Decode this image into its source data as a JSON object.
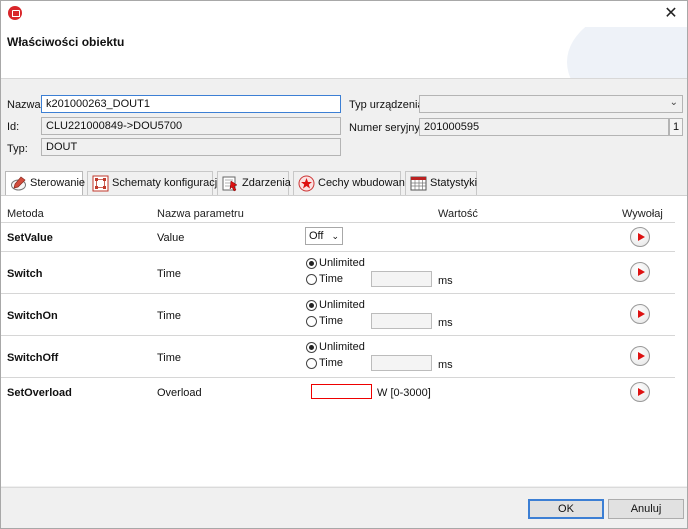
{
  "dialog": {
    "title": "Właściwości obiektu",
    "close_label": "✕"
  },
  "form": {
    "name_label": "Nazwa:",
    "name_value": "k201000263_DOUT1",
    "id_label": "Id:",
    "id_value": "CLU221000849->DOU5700",
    "type_label": "Typ:",
    "type_value": "DOUT",
    "device_type_label": "Typ urządzenia:",
    "device_type_value": "",
    "serial_label": "Numer seryjny:",
    "serial_value": "201000595",
    "serial_count": "1"
  },
  "tabs": [
    {
      "label": "Sterowanie",
      "icon": "pen-icon"
    },
    {
      "label": "Schematy konfiguracji",
      "icon": "schema-icon"
    },
    {
      "label": "Zdarzenia",
      "icon": "events-icon"
    },
    {
      "label": "Cechy wbudowane",
      "icon": "star-icon"
    },
    {
      "label": "Statystyki",
      "icon": "table-icon"
    }
  ],
  "table": {
    "headers": {
      "method": "Metoda",
      "param": "Nazwa parametru",
      "value": "Wartość",
      "invoke": "Wywołaj"
    },
    "rows": [
      {
        "method": "SetValue",
        "param": "Value",
        "select_value": "Off"
      },
      {
        "method": "Switch",
        "param": "Time",
        "opt1": "Unlimited",
        "opt2": "Time",
        "unit": "ms"
      },
      {
        "method": "SwitchOn",
        "param": "Time",
        "opt1": "Unlimited",
        "opt2": "Time",
        "unit": "ms"
      },
      {
        "method": "SwitchOff",
        "param": "Time",
        "opt1": "Unlimited",
        "opt2": "Time",
        "unit": "ms"
      },
      {
        "method": "SetOverload",
        "param": "Overload",
        "unit": "W [0-3000]"
      }
    ]
  },
  "buttons": {
    "ok": "OK",
    "cancel": "Anuluj"
  },
  "colors": {
    "accent": "#3c7fd4",
    "error_border": "#e00000",
    "play": "#d11111",
    "brand": "#d9262a"
  }
}
